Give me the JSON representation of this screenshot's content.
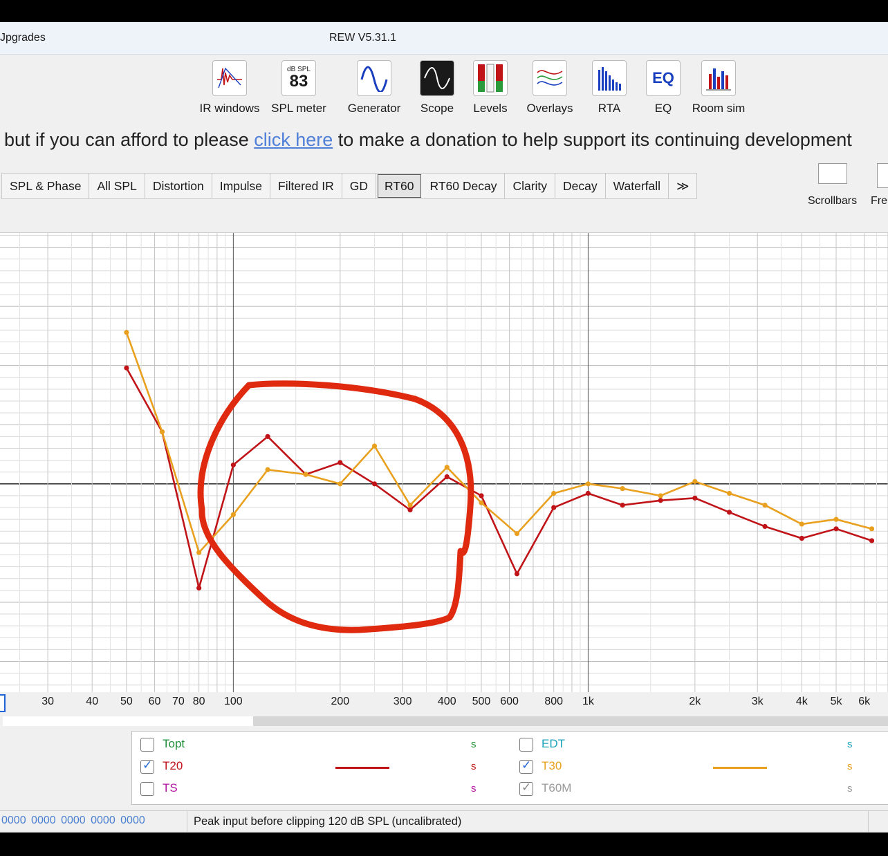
{
  "window": {
    "menu_partial": "Jpgrades",
    "title": "REW V5.31.1"
  },
  "toolbar": [
    {
      "label": "IR windows",
      "icon": "ir-windows-icon"
    },
    {
      "label": "SPL meter",
      "icon": "spl-meter-icon",
      "icon_top": "dB SPL",
      "icon_value": "83"
    },
    {
      "label": "Generator",
      "icon": "generator-icon"
    },
    {
      "label": "Scope",
      "icon": "scope-icon"
    },
    {
      "label": "Levels",
      "icon": "levels-icon"
    },
    {
      "label": "Overlays",
      "icon": "overlays-icon"
    },
    {
      "label": "RTA",
      "icon": "rta-icon"
    },
    {
      "label": "EQ",
      "icon": "eq-icon",
      "icon_text": "EQ"
    },
    {
      "label": "Room sim",
      "icon": "room-sim-icon"
    }
  ],
  "banner": {
    "before": "but if you can afford to please ",
    "link": "click here",
    "after": " to make a donation to help support its continuing development"
  },
  "tabs": [
    "SPL & Phase",
    "All SPL",
    "Distortion",
    "Impulse",
    "Filtered IR",
    "GD",
    "RT60",
    "RT60 Decay",
    "Clarity",
    "Decay",
    "Waterfall",
    "≫"
  ],
  "active_tab": "RT60",
  "side_controls": {
    "scrollbars": "Scrollbars",
    "fre_partial": "Fre"
  },
  "colors": {
    "t20": "#c01418",
    "t30": "#e8a01e",
    "annotation": "#e02a10",
    "topt": "#1f8f3a",
    "edt": "#1aa3b8",
    "ts": "#b0139a",
    "t60m": "#999999"
  },
  "chart_data": {
    "type": "line",
    "x_scale": "log",
    "x_ticks": [
      "30",
      "40",
      "50",
      "60",
      "70",
      "80",
      "100",
      "200",
      "300",
      "400",
      "500",
      "600",
      "800",
      "1k",
      "2k",
      "3k",
      "4k",
      "5k",
      "6k"
    ],
    "xlim": [
      22,
      7000
    ],
    "series": [
      {
        "name": "T20",
        "x": [
          50,
          63,
          80,
          100,
          125,
          160,
          200,
          250,
          315,
          400,
          500,
          630,
          800,
          1000,
          1250,
          1600,
          2000,
          2500,
          3150,
          4000,
          5000,
          6300
        ],
        "y": [
          0.49,
          0.22,
          -0.44,
          0.08,
          0.2,
          0.04,
          0.09,
          0.0,
          -0.11,
          0.03,
          -0.05,
          -0.38,
          -0.1,
          -0.04,
          -0.09,
          -0.07,
          -0.06,
          -0.12,
          -0.18,
          -0.23,
          -0.19,
          -0.24
        ]
      },
      {
        "name": "T30",
        "x": [
          50,
          63,
          80,
          100,
          125,
          160,
          200,
          250,
          315,
          400,
          500,
          630,
          800,
          1000,
          1250,
          1600,
          2000,
          2500,
          3150,
          4000,
          5000,
          6300
        ],
        "y": [
          0.64,
          0.22,
          -0.29,
          -0.13,
          0.06,
          0.04,
          0.0,
          0.16,
          -0.09,
          0.07,
          -0.08,
          -0.21,
          -0.04,
          0.0,
          -0.02,
          -0.05,
          0.01,
          -0.04,
          -0.09,
          -0.17,
          -0.15,
          -0.19
        ]
      }
    ],
    "ylim": [
      -0.88,
      1.06
    ],
    "annotation": "hand-drawn circle"
  },
  "legend": [
    {
      "name": "Topt",
      "checked": false,
      "unit": "s",
      "color": "#1f8f3a"
    },
    {
      "name": "EDT",
      "checked": false,
      "unit": "s",
      "color": "#1aa3b8"
    },
    {
      "name": "T20",
      "checked": true,
      "unit": "s",
      "color": "#c01418"
    },
    {
      "name": "T30",
      "checked": true,
      "unit": "s",
      "color": "#e8a01e"
    },
    {
      "name": "TS",
      "checked": false,
      "unit": "s",
      "color": "#b0139a"
    },
    {
      "name": "T60M",
      "checked": true,
      "unit": "s",
      "color": "#999999"
    }
  ],
  "status": {
    "left": "0000 0000 0000 0000 0000",
    "message": "Peak input before clipping 120 dB SPL (uncalibrated)"
  }
}
